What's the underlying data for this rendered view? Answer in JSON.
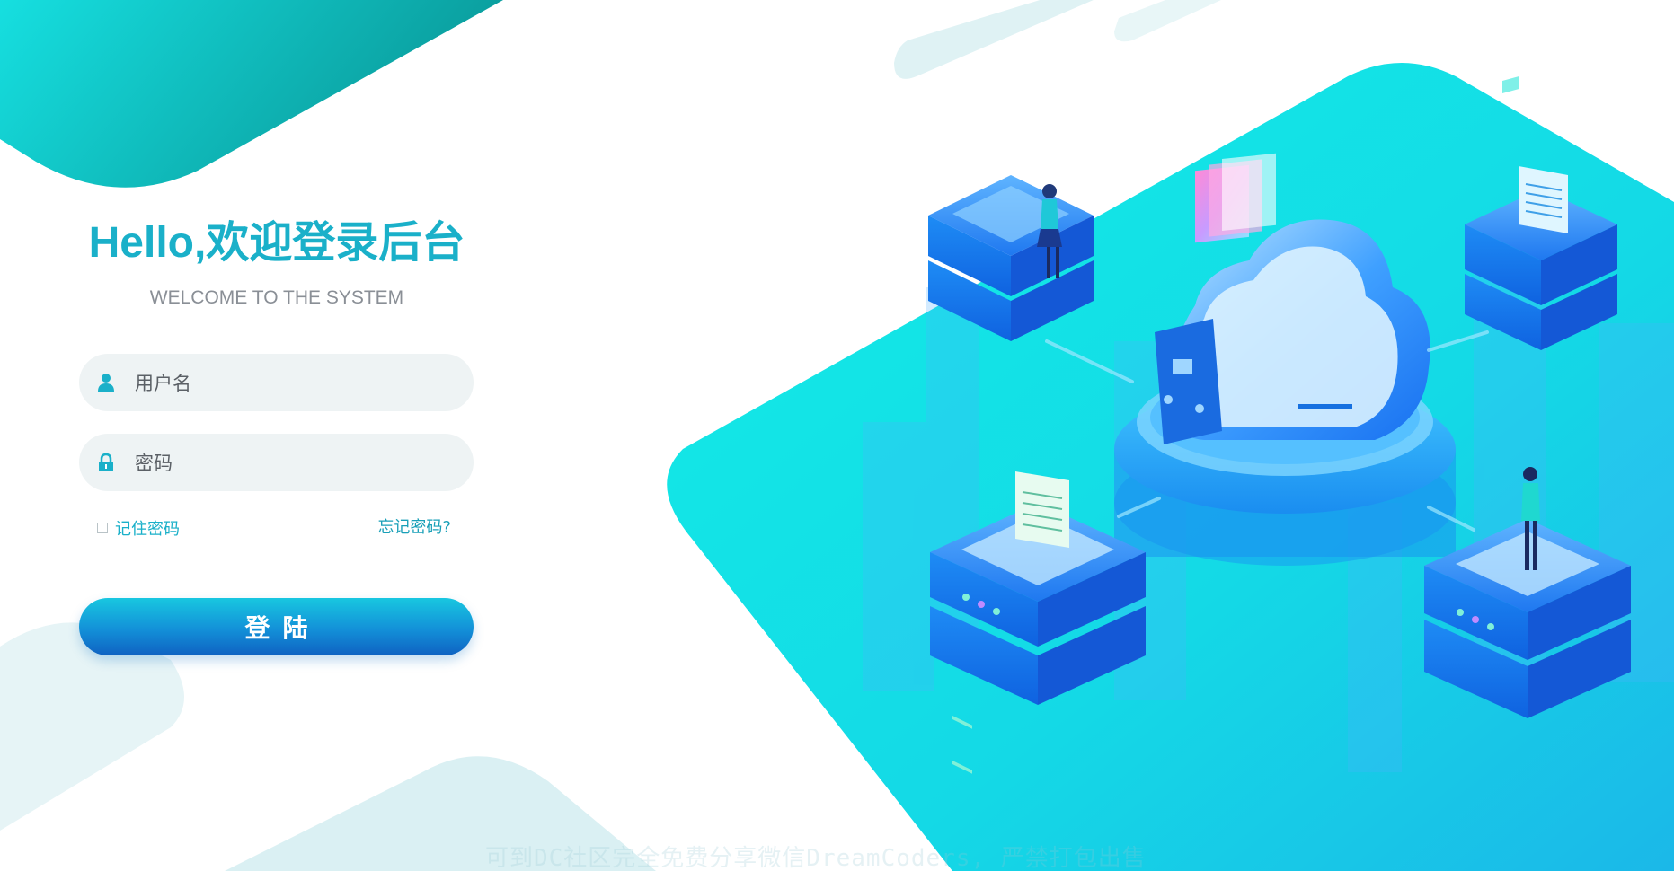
{
  "login": {
    "title": "Hello,欢迎登录后台",
    "subtitle": "WELCOME TO THE SYSTEM",
    "username_placeholder": "用户名",
    "password_placeholder": "密码",
    "remember_label": "记住密码",
    "forgot_label": "忘记密码?",
    "submit_label": "登陆"
  },
  "watermark": "可到DC社区完全免费分享微信DreamCoders, 严禁打包出售",
  "icons": {
    "username": "user-icon",
    "password": "lock-icon"
  },
  "colors": {
    "accent": "#1ab0c9",
    "button_top": "#18c7e0",
    "button_bottom": "#0f62c2",
    "field_bg": "#eef3f4",
    "hero_cyan": "#12e6e2"
  }
}
